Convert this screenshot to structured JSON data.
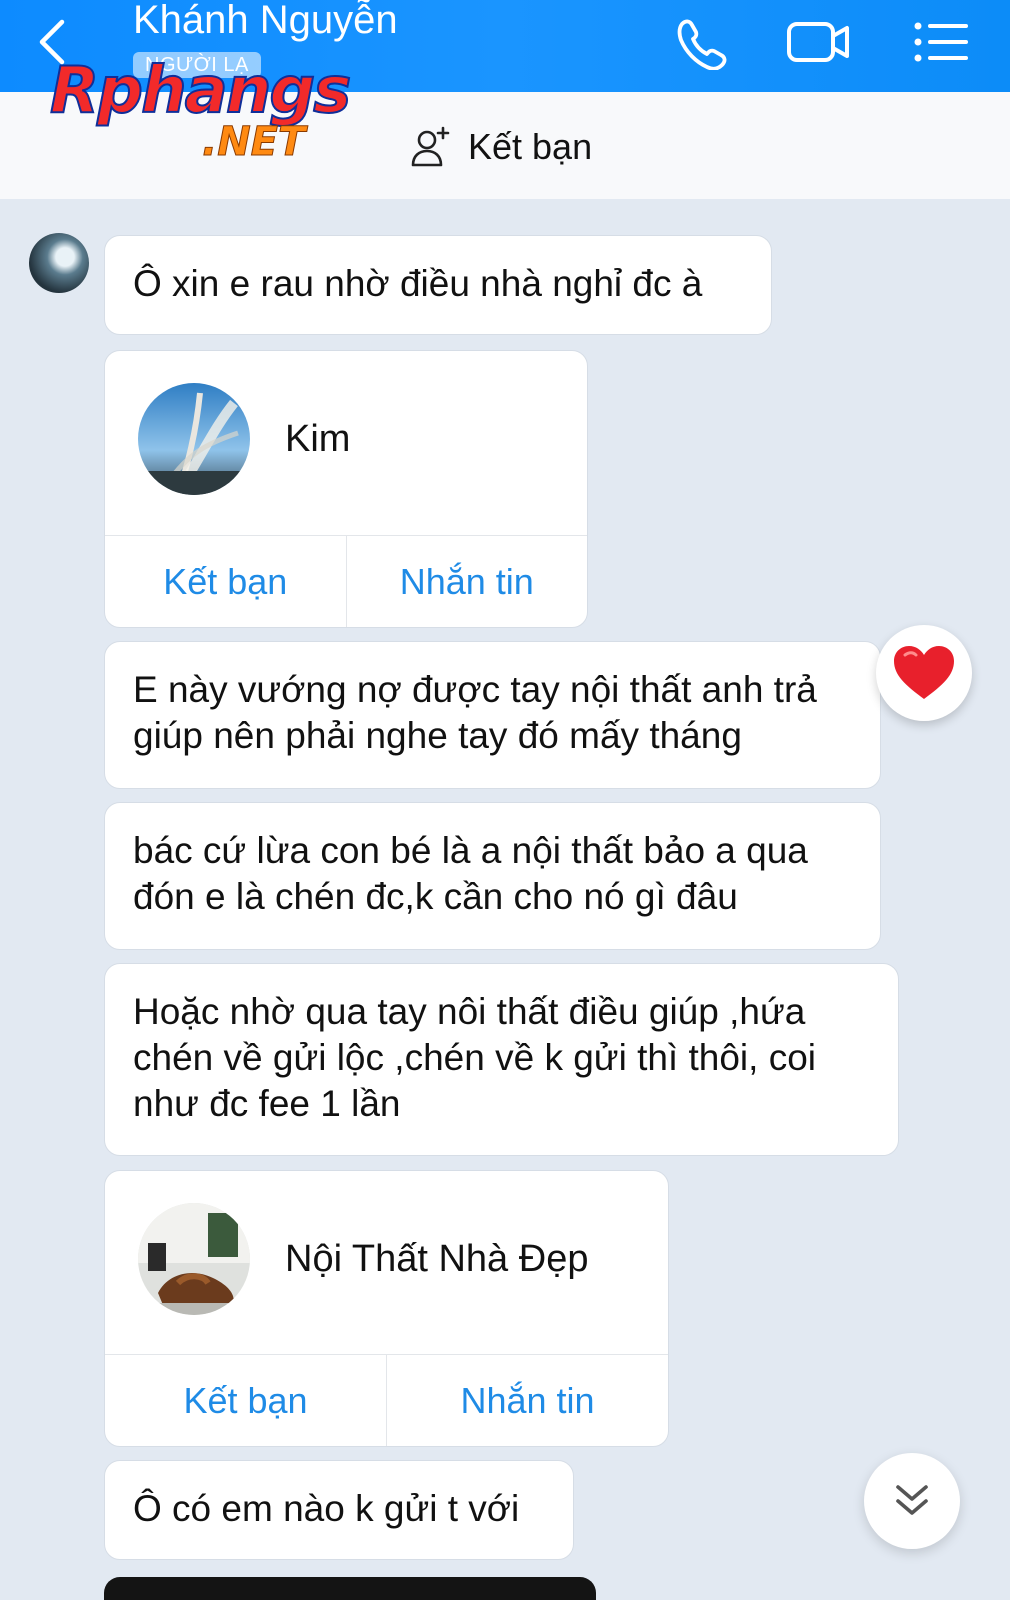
{
  "header": {
    "contact_name": "Khánh Nguyễn",
    "tag": "NGƯỜI LẠ",
    "icons": [
      "back-icon",
      "phone-icon",
      "video-call-icon",
      "menu-list-icon"
    ]
  },
  "watermark": {
    "brand": "Rphangs",
    "domain": ".NET"
  },
  "subheader": {
    "add_friend_label": "Kết bạn",
    "icon": "add-user-icon"
  },
  "messages": [
    {
      "type": "text",
      "text": "Ô xin e rau nhờ điều nhà nghỉ đc à"
    },
    {
      "type": "contact_card",
      "name": "Kim",
      "add_friend": "Kết bạn",
      "message": "Nhắn tin"
    },
    {
      "type": "text",
      "lines": [
        "E này vướng nợ được tay nội thất anh trả",
        "giúp nên phải nghe tay đó mấy tháng"
      ],
      "reaction": "heart"
    },
    {
      "type": "text",
      "lines": [
        "bác cứ lừa con bé là a nội thất bảo a qua",
        "đón e là chén đc,k cần cho nó gì đâu"
      ]
    },
    {
      "type": "text",
      "lines": [
        "Hoặc nhờ qua tay nôi thất điều giúp ,hứa",
        "chén về gửi lộc ,chén về k gửi thì thôi, coi",
        "như đc fee 1 lần"
      ]
    },
    {
      "type": "contact_card",
      "name": "Nội Thất Nhà Đẹp",
      "add_friend": "Kết bạn",
      "message": "Nhắn tin"
    },
    {
      "type": "text",
      "text": "Ô có em nào k gửi t với"
    }
  ],
  "colors": {
    "header_blue": "#1a95ff",
    "link_blue": "#1f8be6",
    "chat_bg": "#e2e9f2",
    "heart_red": "#e8202c"
  }
}
